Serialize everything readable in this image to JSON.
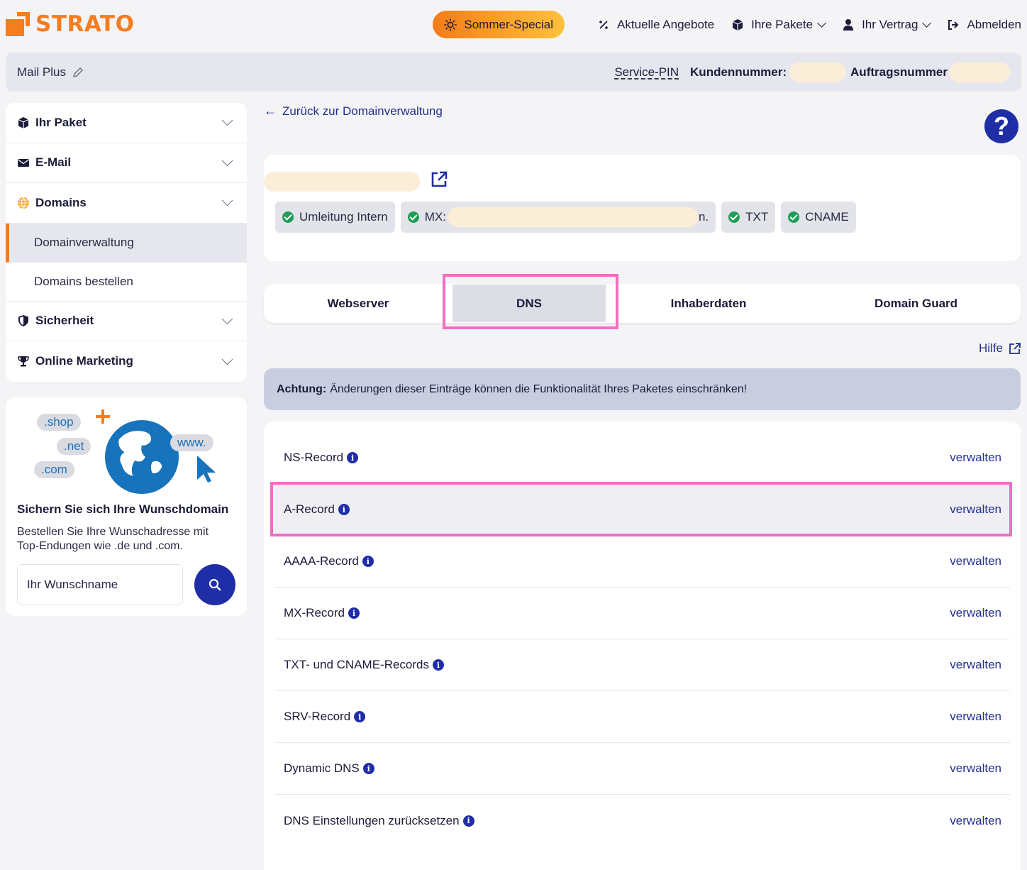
{
  "header": {
    "logo_text": "STRATO",
    "special_label": "Sommer-Special",
    "nav": [
      {
        "label": "Aktuelle Angebote",
        "icon": "percent-icon"
      },
      {
        "label": "Ihre Pakete",
        "icon": "package-icon"
      },
      {
        "label": "Ihr Vertrag",
        "icon": "user-icon"
      },
      {
        "label": "Abmelden",
        "icon": "logout-icon"
      }
    ]
  },
  "infobar": {
    "product": "Mail Plus",
    "service_pin": "Service-PIN",
    "customer_label": "Kundennummer:",
    "order_label": "Auftragsnummer"
  },
  "sidebar": {
    "items": [
      {
        "label": "Ihr Paket",
        "icon": "package-icon"
      },
      {
        "label": "E-Mail",
        "icon": "envelope-icon"
      },
      {
        "label": "Domains",
        "icon": "globe-icon"
      },
      {
        "label": "Sicherheit",
        "icon": "shield-icon"
      },
      {
        "label": "Online Marketing",
        "icon": "trophy-icon"
      }
    ],
    "sub_items": [
      "Domainverwaltung",
      "Domains bestellen"
    ]
  },
  "promo": {
    "bubbles": [
      ".shop",
      ".net",
      ".com",
      "www."
    ],
    "title": "Sichern Sie sich Ihre Wunschdomain",
    "text": "Bestellen Sie Ihre Wunschadresse mit Top-Endungen wie .de und .com.",
    "input_placeholder": "Ihr Wunschname"
  },
  "main": {
    "back_link": "Zurück zur Domainverwaltung",
    "help_symbol": "?",
    "pills": [
      {
        "label": "Umleitung Intern"
      },
      {
        "label": "MX:"
      },
      {
        "label": "TXT"
      },
      {
        "label": "CNAME"
      }
    ],
    "pill_mx_suffix": "n.",
    "tabs": [
      "Webserver",
      "DNS",
      "Inhaberdaten",
      "Domain Guard"
    ],
    "active_tab": "DNS",
    "hilfe": "Hilfe",
    "warning_bold": "Achtung:",
    "warning_text": "Änderungen dieser Einträge können die Funktionalität Ihres Paketes einschränken!",
    "records": [
      {
        "label": "NS-Record",
        "action": "verwalten"
      },
      {
        "label": "A-Record",
        "action": "verwalten"
      },
      {
        "label": "AAAA-Record",
        "action": "verwalten"
      },
      {
        "label": "MX-Record",
        "action": "verwalten"
      },
      {
        "label": "TXT- und CNAME-Records",
        "action": "verwalten"
      },
      {
        "label": "SRV-Record",
        "action": "verwalten"
      },
      {
        "label": "Dynamic DNS",
        "action": "verwalten"
      },
      {
        "label": "DNS Einstellungen zurücksetzen",
        "action": "verwalten"
      }
    ],
    "info_symbol": "i"
  },
  "colors": {
    "brand_orange": "#f57c1f",
    "primary_blue": "#1f2ea6",
    "highlight_pink": "#ef6fc2",
    "check_green": "#1f9d55"
  }
}
